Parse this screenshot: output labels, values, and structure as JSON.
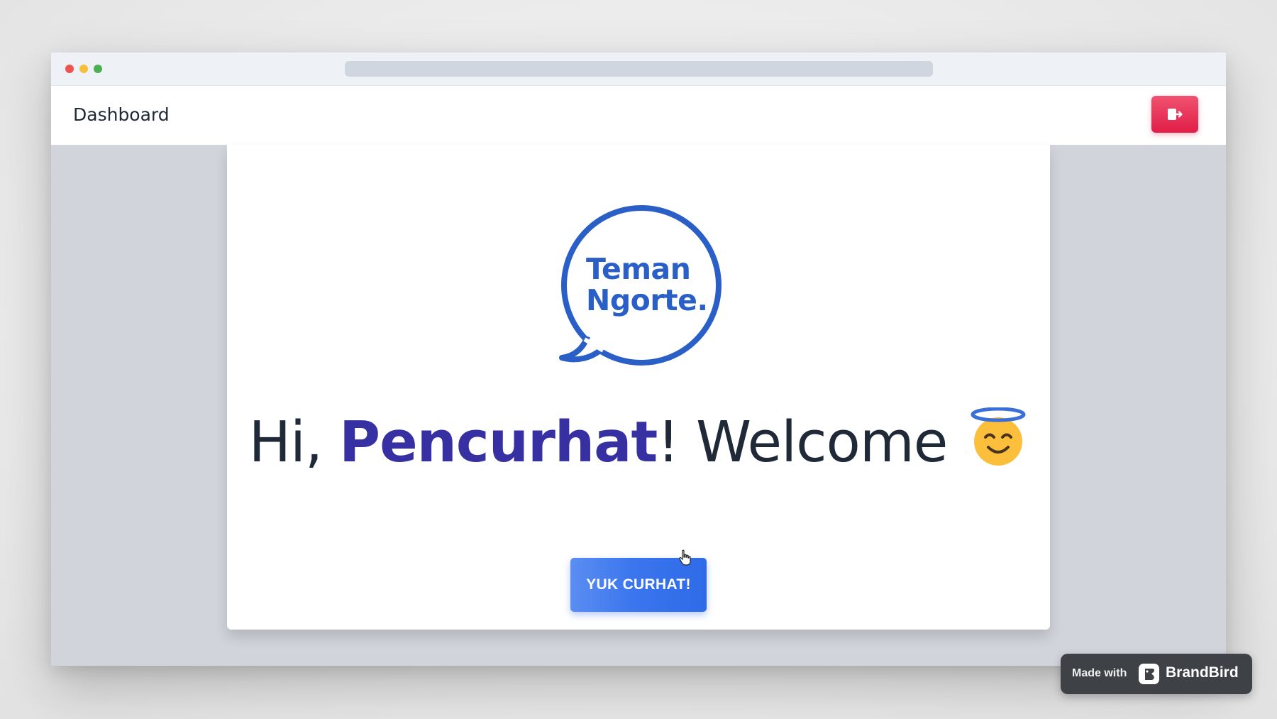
{
  "navbar": {
    "title": "Dashboard",
    "logout_icon": "logout-icon",
    "accent": "#e11d48"
  },
  "logo": {
    "line1": "Teman",
    "line2": "Ngorte.",
    "color": "#2a5fc8"
  },
  "welcome": {
    "greeting": "Hi, ",
    "name": "Pencurhat",
    "suffix": "! Welcome",
    "emoji_icon": "smiling-face-with-halo-icon",
    "name_color": "#3730a3"
  },
  "cta": {
    "label": "YUK CURHAT!",
    "color": "#3b76ee"
  },
  "badge": {
    "made_with": "Made with",
    "brand": "BrandBird"
  }
}
